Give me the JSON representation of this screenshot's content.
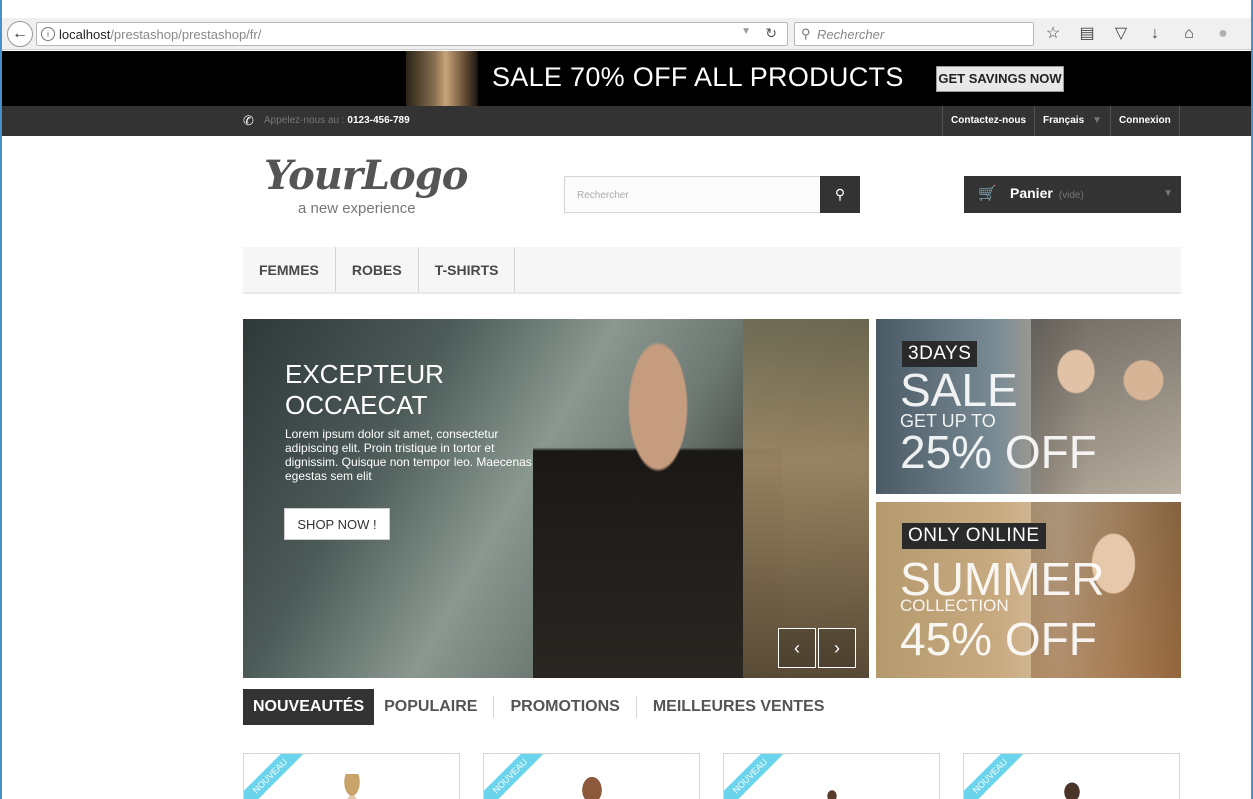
{
  "browser": {
    "url_host": "localhost",
    "url_path": "/prestashop/prestashop/fr/",
    "search_placeholder": "Rechercher"
  },
  "banner": {
    "sale_text": "SALE 70% OFF ALL PRODUCTS",
    "cta": "GET SAVINGS NOW"
  },
  "nav": {
    "call_label": "Appelez-nous au :",
    "phone": "0123-456-789",
    "contact": "Contactez-nous",
    "language": "Français",
    "login": "Connexion"
  },
  "header": {
    "logo_script": "YourLogo",
    "logo_tagline": "a new experience",
    "search_placeholder": "Rechercher",
    "cart_label": "Panier",
    "cart_status": "(vide)"
  },
  "menu": [
    "FEMMES",
    "ROBES",
    "T-SHIRTS"
  ],
  "slider": {
    "title": "EXCEPTEUR OCCAECAT",
    "description": "Lorem ipsum dolor sit amet, consectetur adipiscing elit. Proin tristique in tortor et dignissim. Quisque non tempor leo. Maecenas egestas sem elit",
    "button": "SHOP NOW !"
  },
  "promos": [
    {
      "badge": "3DAYS",
      "big": "SALE",
      "sub": "GET UP TO",
      "pct": "25% OFF"
    },
    {
      "badge": "ONLY ONLINE",
      "big": "SUMMER",
      "sub": "COLLECTION",
      "pct": "45% OFF"
    }
  ],
  "tabs": [
    "NOUVEAUTÉS",
    "POPULAIRE",
    "PROMOTIONS",
    "MEILLEURES VENTES"
  ],
  "product_ribbon": "NOUVEAU",
  "colors": {
    "dark": "#333333",
    "ribbon": "#6ad4ec",
    "browser_border": "#4a90c8"
  }
}
